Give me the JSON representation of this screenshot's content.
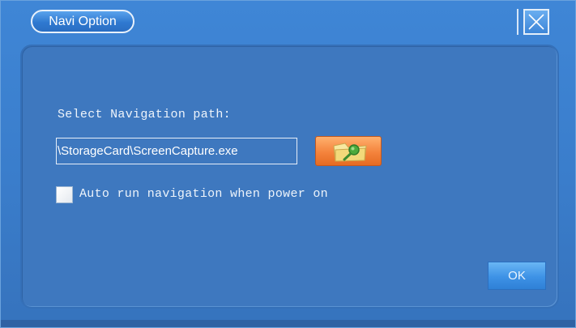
{
  "window": {
    "title": "Navi Option",
    "close_icon": "close-x-icon"
  },
  "form": {
    "path_label": "Select Navigation path:",
    "path_value": "\\StorageCard\\ScreenCapture.exe",
    "browse_icon": "folder-search-icon",
    "auto_run_label": "Auto run navigation when power on",
    "auto_run_checked": false,
    "ok_label": "OK"
  },
  "colors": {
    "window_bg": "#3a7dcb",
    "panel_bg": "#3e78bf",
    "browse_button": "#f4833c",
    "ok_button": "#3d92e6"
  }
}
